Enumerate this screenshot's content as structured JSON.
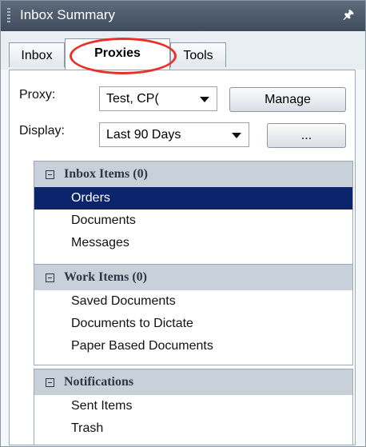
{
  "window": {
    "title": "Inbox Summary",
    "pin_icon": "pin-icon"
  },
  "tabs": [
    {
      "label": "Inbox",
      "active": false
    },
    {
      "label": "Proxies",
      "active": true
    },
    {
      "label": "Tools",
      "active": false
    }
  ],
  "controls": {
    "proxy_label": "Proxy:",
    "proxy_value": "Test, CP(",
    "manage_button": "Manage",
    "display_label": "Display:",
    "display_value": "Last 90 Days",
    "more_button": "..."
  },
  "sections": [
    {
      "title": "Inbox Items (0)",
      "items": [
        "Orders",
        "Documents",
        "Messages"
      ],
      "selected_index": 0
    },
    {
      "title": "Work Items (0)",
      "items": [
        "Saved Documents",
        "Documents to Dictate",
        "Paper Based Documents"
      ]
    },
    {
      "title": "Notifications",
      "items": [
        "Sent Items",
        "Trash"
      ]
    }
  ],
  "colors": {
    "selection": "#0c246b",
    "annotation_circle": "#e8312a",
    "section_header": "#c8d1da"
  }
}
